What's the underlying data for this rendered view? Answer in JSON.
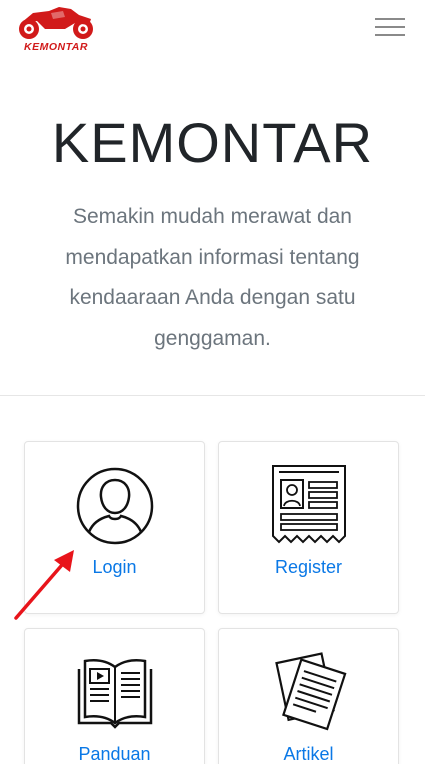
{
  "navbar": {
    "logo_text": "KEMONTAR",
    "logo_icon": "motorcycle-icon",
    "menu_icon": "hamburger-icon"
  },
  "hero": {
    "title": "KEMONTAR",
    "lead": "Semakin mudah merawat dan mendapatkan informasi tentang kendaaraan Anda dengan satu genggaman."
  },
  "cards": [
    {
      "label": "Login",
      "icon": "user-icon"
    },
    {
      "label": "Register",
      "icon": "id-card-icon"
    },
    {
      "label": "Panduan",
      "icon": "book-icon"
    },
    {
      "label": "Artikel",
      "icon": "article-icon"
    }
  ],
  "annotation": {
    "arrow_icon": "red-arrow-icon"
  },
  "colors": {
    "brand_red": "#d11a1a",
    "link_blue": "#0a78e6",
    "muted_text": "#6c757d",
    "title_text": "#212529"
  }
}
